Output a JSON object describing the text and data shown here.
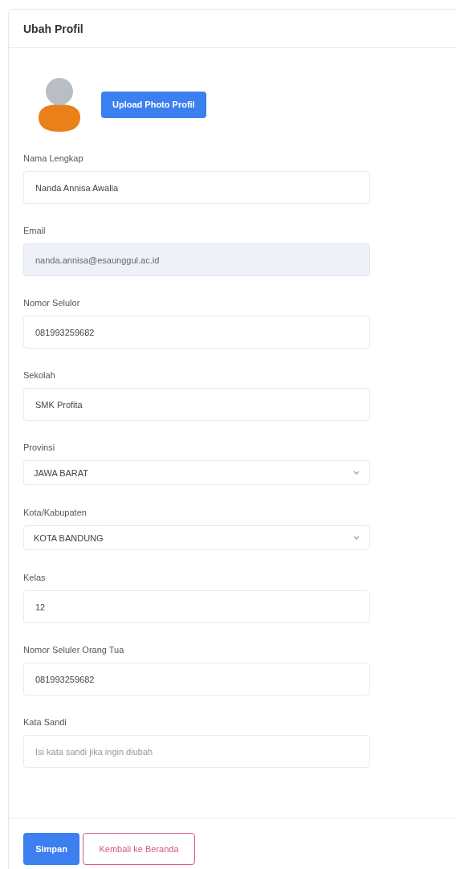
{
  "card": {
    "title": "Ubah Profil"
  },
  "avatar": {
    "upload_button": "Upload Photo Profil"
  },
  "fields": [
    {
      "label": "Nama Lengkap",
      "kind": "text",
      "value": "Nanda Annisa Awalia",
      "disabled": false
    },
    {
      "label": "Email",
      "kind": "text",
      "value": "nanda.annisa@esaunggul.ac.id",
      "disabled": true
    },
    {
      "label": "Nomor Selulor",
      "kind": "text",
      "value": "081993259682",
      "disabled": false
    },
    {
      "label": "Sekolah",
      "kind": "text",
      "value": "SMK Profita",
      "disabled": false
    },
    {
      "label": "Provinsi",
      "kind": "select",
      "value": "JAWA BARAT",
      "disabled": false
    },
    {
      "label": "Kota/Kabupaten",
      "kind": "select",
      "value": "KOTA BANDUNG",
      "disabled": false
    },
    {
      "label": "Kelas",
      "kind": "text",
      "value": "12",
      "disabled": false
    },
    {
      "label": "Nomor Seluler Orang Tua",
      "kind": "text",
      "value": "081993259682",
      "disabled": false
    },
    {
      "label": "Kata Sandi",
      "kind": "password",
      "placeholder": "Isi kata sandi jika ingin diubah",
      "disabled": false
    }
  ],
  "buttons": {
    "save": "Simpan",
    "back": "Kembali ke Beranda"
  }
}
